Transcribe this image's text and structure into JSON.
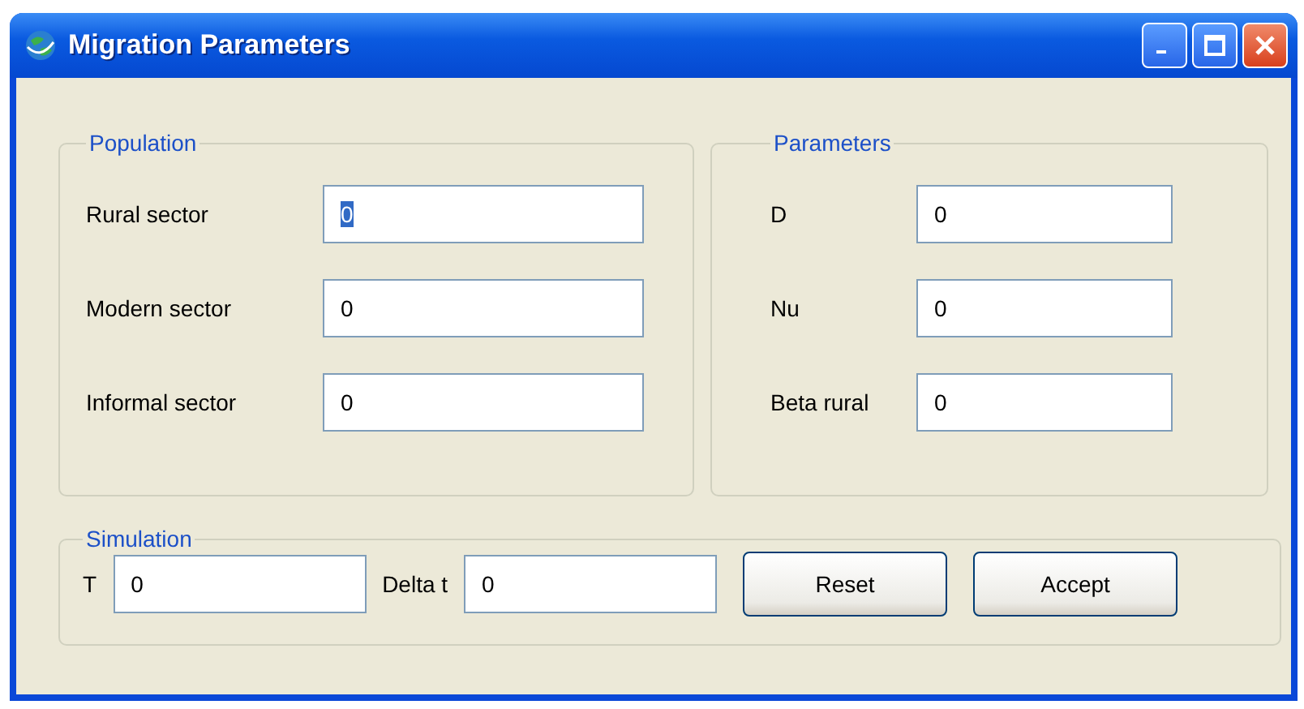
{
  "window": {
    "title": "Migration Parameters"
  },
  "population": {
    "title": "Population",
    "fields": [
      {
        "label": "Rural sector",
        "value": "0",
        "highlighted": true
      },
      {
        "label": "Modern sector",
        "value": "0",
        "highlighted": false
      },
      {
        "label": "Informal sector",
        "value": "0",
        "highlighted": false
      }
    ]
  },
  "parameters": {
    "title": "Parameters",
    "fields": [
      {
        "label": "D",
        "value": "0",
        "highlighted": false
      },
      {
        "label": "Nu",
        "value": "0",
        "highlighted": false
      },
      {
        "label": "Beta rural",
        "value": "0",
        "highlighted": false
      }
    ]
  },
  "simulation": {
    "title": "Simulation",
    "fields": [
      {
        "label": "T",
        "value": "0",
        "highlighted": false
      },
      {
        "label": "Delta t",
        "value": "0",
        "highlighted": false
      }
    ],
    "buttons": [
      "Reset",
      "Accept"
    ]
  }
}
